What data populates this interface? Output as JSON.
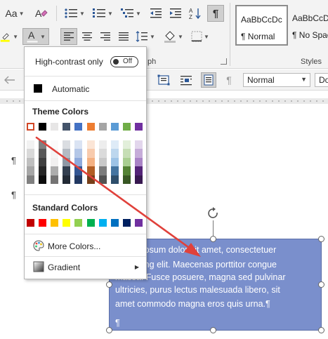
{
  "ribbon": {
    "font_size_button": "Aa",
    "group_paragraph_label": "ph",
    "group_styles_label": "Styles",
    "styles": [
      {
        "sample": "AaBbCcDc",
        "name": "¶ Normal"
      },
      {
        "sample": "AaBbCcDc",
        "name": "¶ No Spac"
      }
    ]
  },
  "toolbar2": {
    "style_value": "Normal",
    "font_value": "Do"
  },
  "menu": {
    "high_contrast_label": "High-contrast only",
    "toggle_state": "Off",
    "automatic_label": "Automatic",
    "theme_colors_title": "Theme Colors",
    "standard_colors_title": "Standard Colors",
    "more_colors_label": "More Colors...",
    "gradient_label": "Gradient",
    "theme_base": [
      "#ffffff",
      "#000000",
      "#e7e6e6",
      "#44546a",
      "#4472c4",
      "#ed7d31",
      "#a5a5a5",
      "#5b9bd5",
      "#70ad47",
      "#7030a0"
    ],
    "standard": [
      "#c00000",
      "#ff0000",
      "#ffc000",
      "#ffff00",
      "#92d050",
      "#00b050",
      "#00b0f0",
      "#0070c0",
      "#002060",
      "#7030a0"
    ]
  },
  "document": {
    "pilcrow": "¶",
    "textbox_lines": [
      "Lorem ipsum dolor sit amet, consectetuer",
      "adipiscing elit. Maecenas porttitor congue",
      "massa. Fusce posuere, magna sed pulvinar",
      "ultricies, purus lectus malesuada libero, sit",
      "amet commodo magna eros quis urna.¶",
      "",
      "¶"
    ],
    "textbox_fill": "#7a8fcc"
  },
  "annotation": {
    "arrow_color": "#e0413b"
  }
}
